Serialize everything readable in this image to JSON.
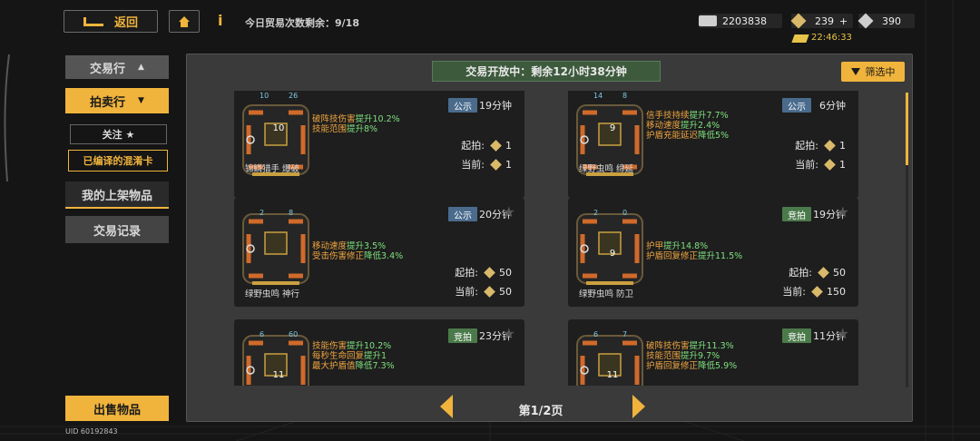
{
  "header": {
    "back_label": "返回",
    "home_icon": "home-icon",
    "info_icon": "info-icon",
    "trade_count": "今日贸易次数剩余：9/18"
  },
  "currency": {
    "coins": "2203838",
    "gold": "239",
    "gold_plus": "+",
    "crystal": "390",
    "timer": "22:46:33"
  },
  "sidebar": {
    "items": [
      {
        "label": "交易行"
      },
      {
        "label": "拍卖行"
      },
      {
        "label": "关注 ★"
      },
      {
        "label": "已编译的混淆卡"
      },
      {
        "label": "我的上架物品"
      },
      {
        "label": "交易记录"
      }
    ],
    "sell_label": "出售物品",
    "uid": "UID 60192843"
  },
  "main": {
    "banner": "交易开放中：剩余12小时38分钟",
    "filter_label": "筛选中",
    "page_label": "第1/2页",
    "start_label": "起拍:",
    "current_label": "当前:"
  },
  "cards": [
    {
      "tag": "公示",
      "tag_type": "pub",
      "time": "19分钟",
      "top_left": "10",
      "top_right": "26",
      "level": "10",
      "effects": [
        [
          "破阵技伤害",
          "提升10.2%"
        ],
        [
          "技能范围",
          "提升8%"
        ]
      ],
      "start": "1",
      "current": "1",
      "name": "锦鳞猎手 爆破"
    },
    {
      "tag": "公示",
      "tag_type": "pub",
      "time": "6分钟",
      "top_left": "14",
      "top_right": "8",
      "level": "9",
      "effects": [
        [
          "信手技持续",
          "提升7.7%"
        ],
        [
          "移动速度",
          "提升2.4%"
        ],
        [
          "护盾充能延迟",
          "降低5%"
        ]
      ],
      "start": "1",
      "current": "1",
      "name": "绿野虫鸣 缔延"
    },
    {
      "tag": "公示",
      "tag_type": "pub",
      "time": "20分钟",
      "top_left": "2",
      "top_right": "8",
      "level": "",
      "effects": [
        [
          "移动速度",
          "提升3.5%"
        ],
        [
          "受击伤害修正",
          "降低3.4%"
        ]
      ],
      "start": "50",
      "current": "50",
      "name": "绿野虫鸣 神行"
    },
    {
      "tag": "竞拍",
      "tag_type": "auc",
      "time": "19分钟",
      "top_left": "2",
      "top_right": "0",
      "level": "9",
      "effects": [
        [
          "护甲",
          "提升14.8%"
        ],
        [
          "护盾回复修正",
          "提升11.5%"
        ]
      ],
      "start": "50",
      "current": "150",
      "name": "绿野虫鸣 防卫"
    },
    {
      "tag": "竞拍",
      "tag_type": "auc",
      "time": "23分钟",
      "top_left": "6",
      "top_right": "60",
      "level": "11",
      "effects": [
        [
          "技能伤害",
          "提升10.2%"
        ],
        [
          "每秒生命回复",
          "提升1"
        ],
        [
          "最大护盾值",
          "降低7.3%"
        ]
      ],
      "start": "",
      "current": "",
      "name": ""
    },
    {
      "tag": "竞拍",
      "tag_type": "auc",
      "time": "11分钟",
      "top_left": "6",
      "top_right": "7",
      "level": "11",
      "effects": [
        [
          "破阵技伤害",
          "提升11.3%"
        ],
        [
          "技能范围",
          "提升9.7%"
        ],
        [
          "护盾回复修正",
          "降低5.9%"
        ]
      ],
      "start": "",
      "current": "",
      "name": ""
    }
  ]
}
